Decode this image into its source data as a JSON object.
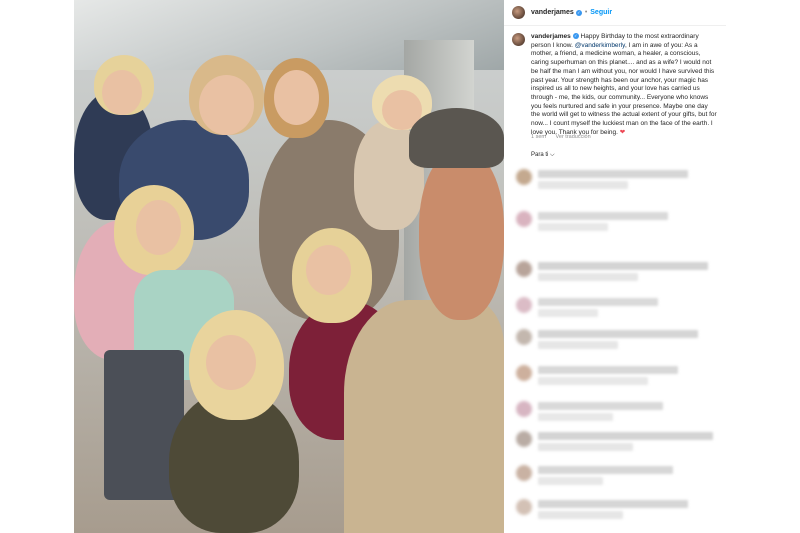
{
  "post": {
    "username": "vanderjames",
    "follow_label": "Seguir",
    "separator": "•",
    "verified_icon": "verified-badge-icon",
    "photo_alt": "Family selfie at airport curb"
  },
  "caption": {
    "username": "vanderjames",
    "part1": " Happy Birthday to the most extraordinary person I know. ",
    "mention": "@vanderkimberly",
    "part2": ", I am in awe of you: As a mother, a friend, a medicine woman, a healer, a conscious, caring superhuman on this planet.... and as a wife? I would not be half the man I am without you, nor would I have survived this past year. Your strength has been our anchor, your magic has inspired us all to new heights, and your love has carried us through - me, the kids, our community... Everyone who knows you feels nurtured and safe in your presence. Maybe one day the world will get to witness the actual extent of your gifts, but for now... I count myself the luckiest man on the face of the earth. I love you. Thank you for being. ",
    "heart": "❤",
    "time": "1 sem",
    "translate": "Ver traducción"
  },
  "comments_section": {
    "label": "Para ti ⌵"
  },
  "colors": {
    "link": "#0095f6",
    "mention": "#00376b",
    "heart": "#ed4956",
    "meta": "#8e8e8e",
    "text": "#262626"
  }
}
